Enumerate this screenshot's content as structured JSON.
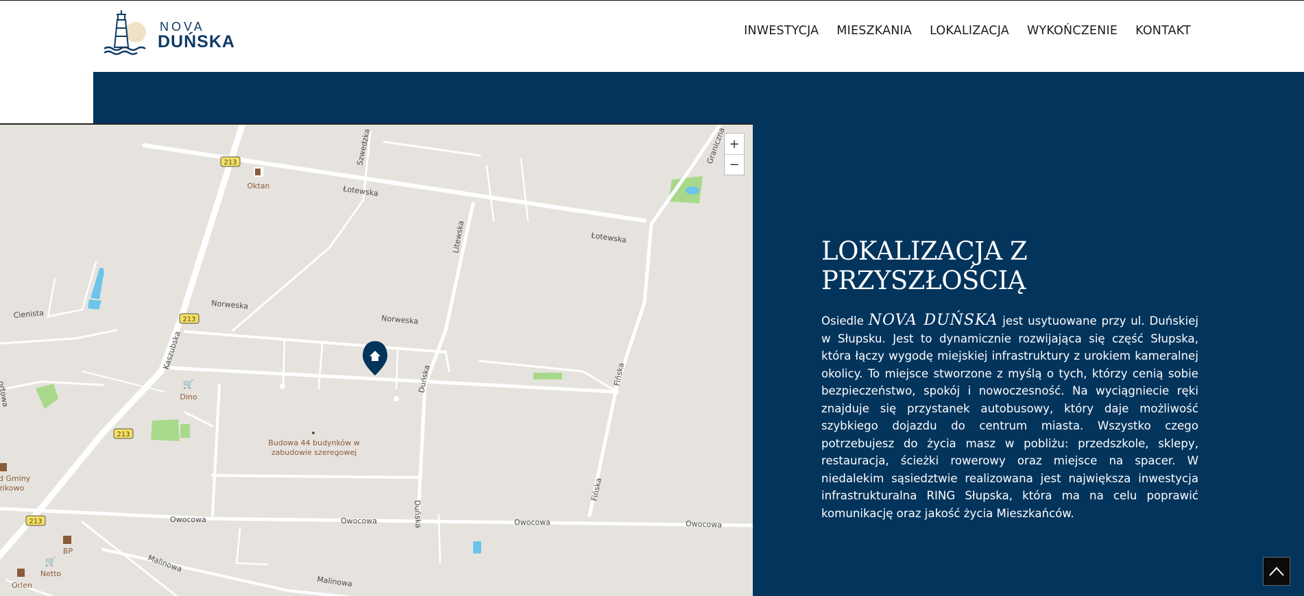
{
  "brand": {
    "line1": "NOVA",
    "line2": "DUŃSKA"
  },
  "nav": [
    {
      "label": "INWESTYCJA"
    },
    {
      "label": "MIESZKANIA"
    },
    {
      "label": "LOKALIZACJA"
    },
    {
      "label": "WYKOŃCZENIE"
    },
    {
      "label": "KONTAKT"
    }
  ],
  "map": {
    "zoom_in": "+",
    "zoom_out": "−",
    "streets": {
      "lotewska_1": "Łotewska",
      "lotewska_2": "Łotewska",
      "norweska_1": "Norweska",
      "norweska_2": "Norweska",
      "litewska": "Litewska",
      "szwedzka": "Szwedzka",
      "graniczna": "Graniczna",
      "cienista": "Cienista",
      "kaszubska": "Kaszubska",
      "dunska_1": "Duńska",
      "dunska_2": "Duńska",
      "finska_1": "Fińska",
      "finska_2": "Fińska",
      "owocowa_1": "Owocowa",
      "owocowa_2": "Owocowa",
      "owocowa_3": "Owocowa",
      "owocowa_4": "Owocowa",
      "malinowa_1": "Malinowa",
      "malinowa_2": "Malinowa",
      "sportowa": "ortowa"
    },
    "road_badges": [
      "213",
      "213",
      "213",
      "213"
    ],
    "pois": {
      "oktan": "Oktan",
      "dino": "Dino",
      "bp": "BP",
      "netto": "Netto",
      "orlen": "Orlen",
      "gmina_1": "d Gminy",
      "gmina_2": "zikowo",
      "budowa_1": "Budowa 44 budynków w",
      "budowa_2": "zabudowie szeregowej"
    }
  },
  "section": {
    "title": "LOKALIZACJA Z PRZYSZŁOŚCIĄ",
    "text_before": "Osiedle ",
    "brand_inline": "NOVA DUŃSKA",
    "text_after": " jest usytuowane przy ul. Duńskiej w Słupsku. Jest to dynamicznie rozwijająca się część Słupska, która łączy wygodę miejskiej infrastruktury z urokiem kameralnej okolicy. To miejsce stworzone z myślą o tych, którzy cenią sobie bezpieczeństwo, spokój i nowoczesność. Na wyciągniecie ręki znajduje się przystanek autobusowy, który daje możliwość szybkiego dojazdu do centrum miasta. Wszystko czego potrzebujesz do życia masz w pobliżu: przedszkole, sklepy, restauracja, ścieżki rowerowy oraz miejsce na spacer. W niedalekim sąsiedztwie realizowana jest największa inwestycja infrastrukturalna RING Słupska, która ma na celu poprawić komunikację oraz jakość życia Mieszkańców."
  },
  "colors": {
    "navy": "#03345c",
    "brand": "#0f3a66",
    "map_bg": "#e6e3de",
    "park": "#a8d98a",
    "water": "#6cc4ea",
    "badge": "#f5e05a"
  }
}
